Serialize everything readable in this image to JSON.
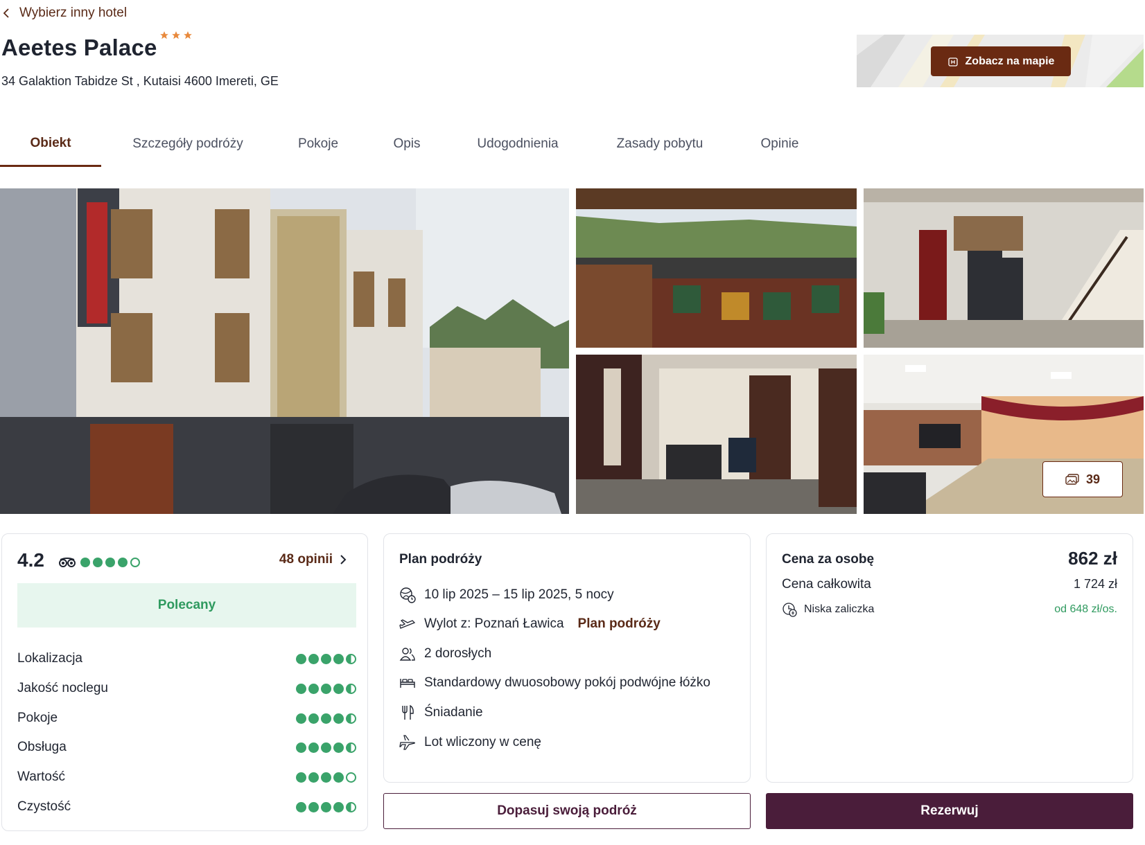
{
  "nav": {
    "back_label": "Wybierz inny hotel"
  },
  "hotel": {
    "name": "Aeetes Palace",
    "stars": 3,
    "address": "34 Galaktion Tabidze St , Kutaisi 4600 Imereti, GE"
  },
  "map": {
    "button_label": "Zobacz na mapie"
  },
  "tabs": [
    {
      "label": "Obiekt",
      "active": true
    },
    {
      "label": "Szczegóły podróży",
      "active": false
    },
    {
      "label": "Pokoje",
      "active": false
    },
    {
      "label": "Opis",
      "active": false
    },
    {
      "label": "Udogodnienia",
      "active": false
    },
    {
      "label": "Zasady pobytu",
      "active": false
    },
    {
      "label": "Opinie",
      "active": false
    }
  ],
  "gallery": {
    "photo_count": "39"
  },
  "rating": {
    "score": "4.2",
    "tripadvisor_bubbles": 4,
    "reviews_link": "48 opinii",
    "badge": "Polecany",
    "categories": [
      {
        "label": "Lokalizacja",
        "bubbles": 4.5
      },
      {
        "label": "Jakość noclegu",
        "bubbles": 4.5
      },
      {
        "label": "Pokoje",
        "bubbles": 4.5
      },
      {
        "label": "Obsługa",
        "bubbles": 4.5
      },
      {
        "label": "Wartość",
        "bubbles": 4
      },
      {
        "label": "Czystość",
        "bubbles": 4.5
      }
    ]
  },
  "plan": {
    "title": "Plan podróży",
    "dates": "10 lip 2025 – 15 lip 2025, 5 nocy",
    "departure": "Wylot z: Poznań Ławica",
    "plan_link": "Plan podróży",
    "guests": "2 dorosłych",
    "room": "Standardowy dwuosobowy pokój podwójne łóżko",
    "board": "Śniadanie",
    "flight": "Lot wliczony w cenę"
  },
  "price": {
    "per_person_label": "Cena za osobę",
    "per_person_value": "862 zł",
    "total_label": "Cena całkowita",
    "total_value": "1 724 zł",
    "deposit_label": "Niska zaliczka",
    "deposit_value": "od 648 zł/os."
  },
  "actions": {
    "customize_label": "Dopasuj swoją podróż",
    "book_label": "Rezerwuj"
  },
  "colors": {
    "brand_brown": "#6a2a12",
    "book_purple": "#4a1d3a",
    "rating_green": "#3aa36a",
    "star_orange": "#e8893c"
  }
}
